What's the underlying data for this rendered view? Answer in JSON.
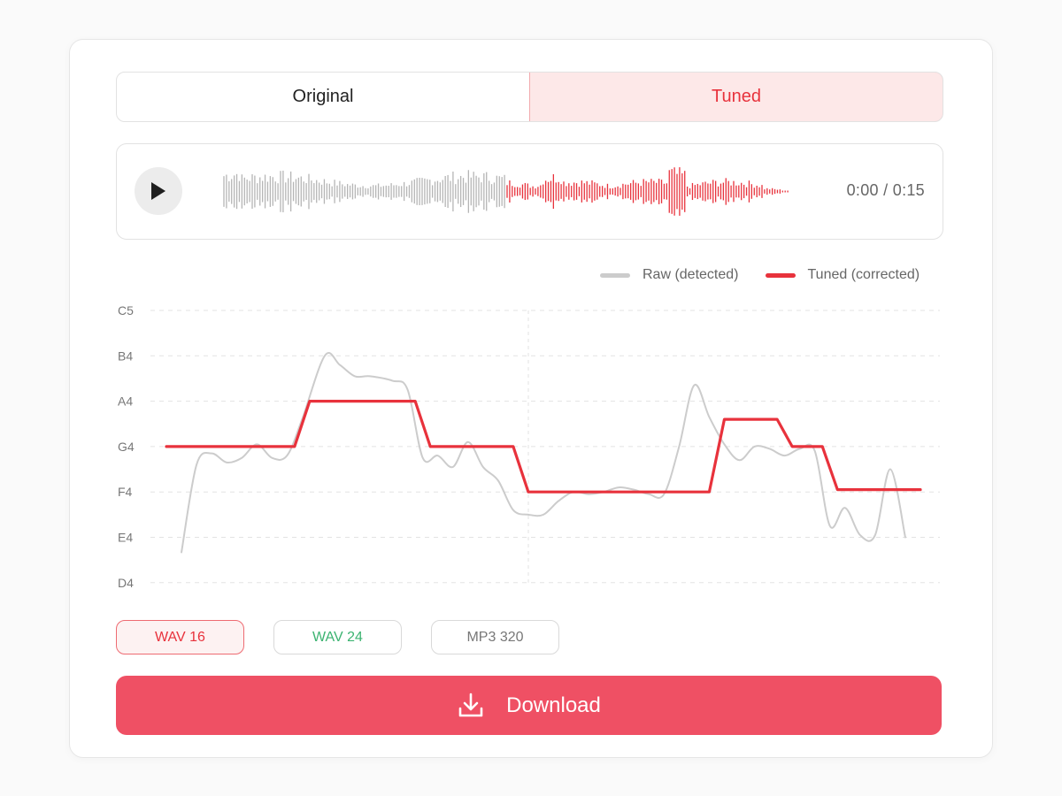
{
  "toggle": {
    "original_label": "Original",
    "tuned_label": "Tuned",
    "selected": "Tuned"
  },
  "player": {
    "time": "0:00 / 0:15",
    "progress": 0.5,
    "play_icon": "play-icon"
  },
  "legend": {
    "raw_label": "Raw (detected)",
    "tuned_label": "Tuned (corrected)",
    "raw_color": "#cccccc",
    "tuned_color": "#e8323c"
  },
  "chart_data": {
    "type": "line",
    "y_ticks": [
      "C5",
      "B4",
      "A4",
      "G4",
      "F4",
      "E4",
      "D4"
    ],
    "series": [
      {
        "name": "Raw (detected)",
        "color": "#cccccc",
        "points": [
          [
            0.02,
            5.33
          ],
          [
            0.04,
            3.4
          ],
          [
            0.06,
            3.15
          ],
          [
            0.08,
            3.35
          ],
          [
            0.1,
            3.25
          ],
          [
            0.12,
            2.95
          ],
          [
            0.14,
            3.25
          ],
          [
            0.16,
            3.2
          ],
          [
            0.18,
            2.4
          ],
          [
            0.21,
            1.0
          ],
          [
            0.23,
            1.2
          ],
          [
            0.25,
            1.45
          ],
          [
            0.27,
            1.45
          ],
          [
            0.3,
            1.55
          ],
          [
            0.32,
            1.75
          ],
          [
            0.34,
            3.25
          ],
          [
            0.36,
            3.2
          ],
          [
            0.38,
            3.45
          ],
          [
            0.4,
            2.9
          ],
          [
            0.42,
            3.45
          ],
          [
            0.44,
            3.75
          ],
          [
            0.46,
            4.4
          ],
          [
            0.48,
            4.5
          ],
          [
            0.5,
            4.5
          ],
          [
            0.52,
            4.2
          ],
          [
            0.54,
            4.0
          ],
          [
            0.56,
            4.05
          ],
          [
            0.58,
            4.0
          ],
          [
            0.6,
            3.9
          ],
          [
            0.62,
            3.95
          ],
          [
            0.64,
            4.05
          ],
          [
            0.66,
            4.05
          ],
          [
            0.68,
            3.0
          ],
          [
            0.7,
            1.65
          ],
          [
            0.72,
            2.35
          ],
          [
            0.74,
            2.95
          ],
          [
            0.76,
            3.3
          ],
          [
            0.78,
            3.0
          ],
          [
            0.8,
            3.05
          ],
          [
            0.82,
            3.2
          ],
          [
            0.84,
            3.05
          ],
          [
            0.86,
            3.1
          ],
          [
            0.88,
            4.75
          ],
          [
            0.9,
            4.35
          ],
          [
            0.92,
            4.95
          ],
          [
            0.94,
            4.95
          ],
          [
            0.96,
            3.5
          ],
          [
            0.98,
            5.0
          ]
        ]
      },
      {
        "name": "Tuned (corrected)",
        "color": "#e8323c",
        "points": [
          [
            0.0,
            3.0
          ],
          [
            0.17,
            3.0
          ],
          [
            0.19,
            2.0
          ],
          [
            0.33,
            2.0
          ],
          [
            0.35,
            3.0
          ],
          [
            0.46,
            3.0
          ],
          [
            0.48,
            4.0
          ],
          [
            0.72,
            4.0
          ],
          [
            0.74,
            2.4
          ],
          [
            0.81,
            2.4
          ],
          [
            0.83,
            3.0
          ],
          [
            0.87,
            3.0
          ],
          [
            0.89,
            3.95
          ],
          [
            1.0,
            3.95
          ]
        ]
      }
    ]
  },
  "formats": [
    {
      "label": "WAV 16",
      "selected": true
    },
    {
      "label": "WAV 24",
      "selected": false
    },
    {
      "label": "MP3 320",
      "selected": false
    }
  ],
  "download": {
    "label": "Download",
    "icon": "download-icon"
  }
}
